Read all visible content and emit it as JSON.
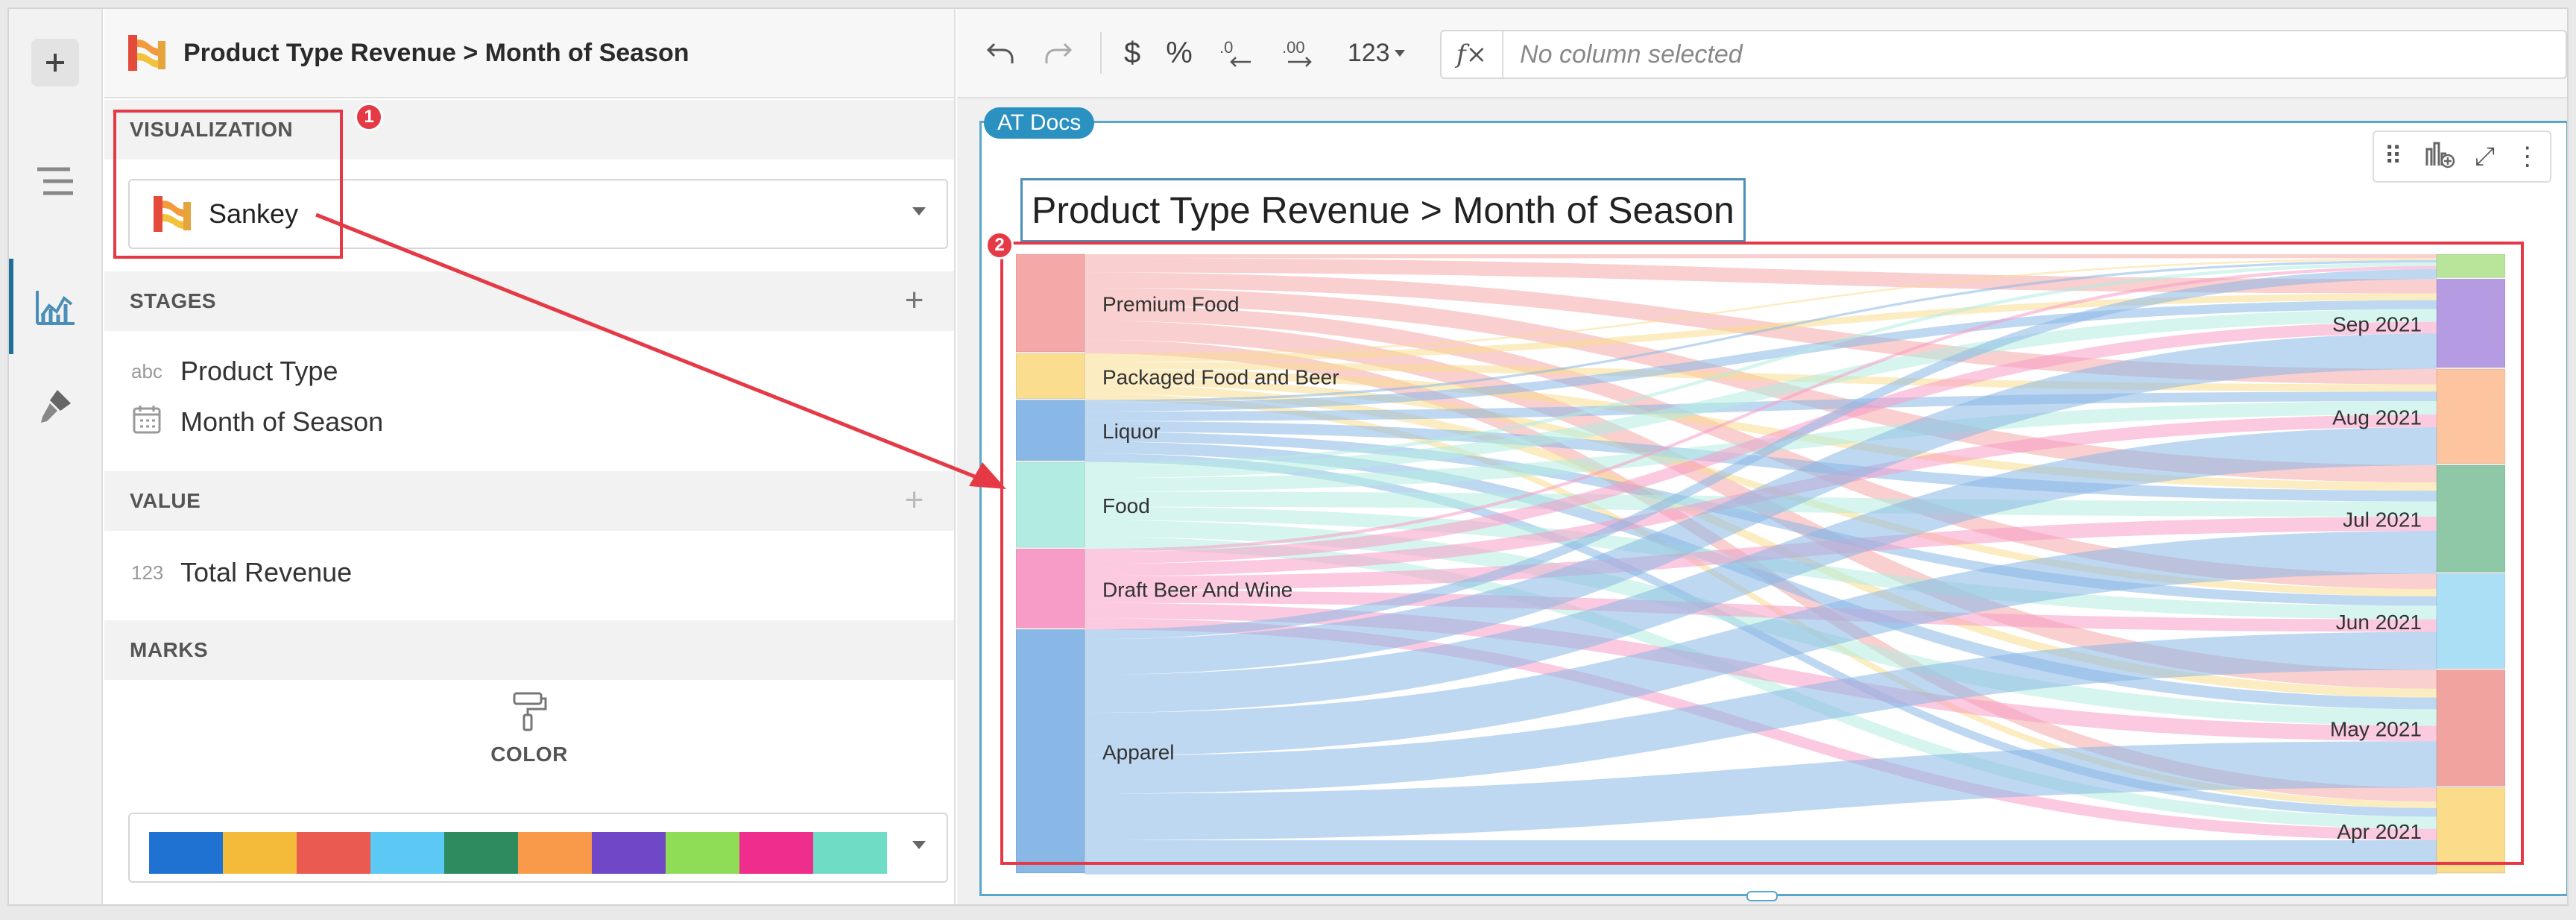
{
  "panel": {
    "title": "Product Type Revenue > Month of Season",
    "visualization_header": "VISUALIZATION",
    "visualization_value": "Sankey",
    "stages_header": "STAGES",
    "stages": [
      {
        "type": "abc",
        "label": "Product Type"
      },
      {
        "type": "calendar-icon",
        "label": "Month of Season"
      }
    ],
    "value_header": "VALUE",
    "value": {
      "type": "123",
      "label": "Total Revenue"
    },
    "marks_header": "MARKS",
    "color_label": "COLOR",
    "palette": [
      "#1f72d1",
      "#f4bb3b",
      "#eb5a51",
      "#5cc8f4",
      "#2e8a5f",
      "#f99a4b",
      "#6f47c7",
      "#8fdc56",
      "#ef2d8c",
      "#6fdcc6"
    ]
  },
  "toolbar": {
    "currency": "$",
    "percent": "%",
    "number_format": "123",
    "formula_placeholder": "No column selected"
  },
  "canvas": {
    "tag": "AT Docs",
    "chart_title": "Product Type Revenue > Month of Season"
  },
  "callouts": [
    "1",
    "2"
  ],
  "chart_data": {
    "type": "sankey",
    "sources": [
      {
        "label": "Premium Food",
        "share": 0.16,
        "color": "#f4a8a8"
      },
      {
        "label": "Packaged Food and Beer",
        "share": 0.075,
        "color": "#fadd8f"
      },
      {
        "label": "Liquor",
        "share": 0.1,
        "color": "#8ab8e6"
      },
      {
        "label": "Food",
        "share": 0.14,
        "color": "#b2ece0"
      },
      {
        "label": "Draft Beer And Wine",
        "share": 0.13,
        "color": "#f79cc6"
      },
      {
        "label": "Apparel",
        "share": 0.395,
        "color": "#8ab8e6"
      }
    ],
    "targets": [
      {
        "label": "",
        "share": 0.04,
        "color": "#b9e59a"
      },
      {
        "label": "Sep 2021",
        "share": 0.145,
        "color": "#b49be2"
      },
      {
        "label": "Aug 2021",
        "share": 0.155,
        "color": "#fcc49f"
      },
      {
        "label": "Jul 2021",
        "share": 0.175,
        "color": "#8ec8a6"
      },
      {
        "label": "Jun 2021",
        "share": 0.155,
        "color": "#abdff6"
      },
      {
        "label": "May 2021",
        "share": 0.19,
        "color": "#f1a3a0"
      },
      {
        "label": "Apr 2021",
        "share": 0.14,
        "color": "#fbdc8b"
      }
    ]
  }
}
